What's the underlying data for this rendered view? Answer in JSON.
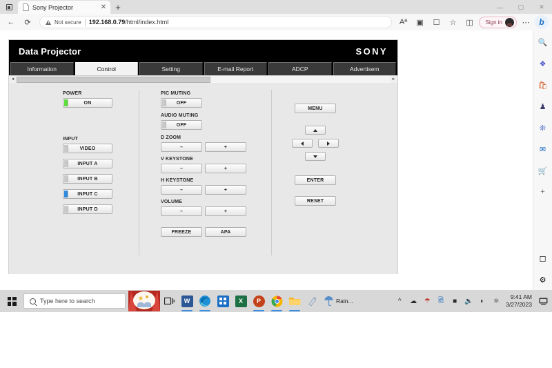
{
  "browser": {
    "tab": {
      "title": "Sony Projector",
      "close_label": "✕",
      "favicon": "page-icon"
    },
    "new_tab_label": "+",
    "tab_actions_icon": "tab-actions-icon",
    "window_controls": {
      "minimize": "—",
      "maximize": "▢",
      "close": "✕"
    },
    "nav": {
      "back": "←",
      "forward": "→",
      "refresh": "⟳"
    },
    "omnibox": {
      "security_label": "Not secure",
      "url_host": "192.168.0.79",
      "url_path": "/html/index.html"
    },
    "toolbar_icons": [
      "read-aloud-icon",
      "zoom-icon",
      "collections-icon",
      "favorites-icon",
      "split-screen-icon"
    ],
    "signin": {
      "label": "Sign in",
      "avatar": "user-avatar"
    },
    "copilot_label": "b",
    "sidebar_icons": [
      "search-icon",
      "discover-icon",
      "shopping-bag-icon",
      "games-icon",
      "copilot-icon",
      "outlook-icon",
      "shopping-cart-icon",
      "add-icon"
    ],
    "sidebar_bottom_icons": [
      "browser-essentials-icon",
      "settings-gear-icon"
    ]
  },
  "page": {
    "header": {
      "title": "Data Projector",
      "brand": "SONY"
    },
    "tabs": [
      {
        "label": "Information",
        "active": false
      },
      {
        "label": "Control",
        "active": true
      },
      {
        "label": "Setting",
        "active": false
      },
      {
        "label": "E-mail Report",
        "active": false
      },
      {
        "label": "ADCP",
        "active": false
      },
      {
        "label": "Advertisem",
        "active": false
      }
    ],
    "scrollbar": {
      "left_arrow": "◄",
      "right_arrow": "►",
      "thumb_percent": 52
    },
    "power": {
      "label": "POWER",
      "button": "ON",
      "indicator_color": "#5ddc3c",
      "state": "on"
    },
    "input": {
      "label": "INPUT",
      "items": [
        {
          "label": "VIDEO",
          "selected": false
        },
        {
          "label": "INPUT A",
          "selected": false
        },
        {
          "label": "INPUT B",
          "selected": false
        },
        {
          "label": "INPUT C",
          "selected": true
        },
        {
          "label": "INPUT D",
          "selected": false
        }
      ],
      "selected_color": "#2f8ade"
    },
    "pic_muting": {
      "label": "PIC MUTING",
      "button": "OFF"
    },
    "audio_muting": {
      "label": "AUDIO MUTING",
      "button": "OFF"
    },
    "d_zoom": {
      "label": "D ZOOM",
      "minus": "–",
      "plus": "+"
    },
    "v_keystone": {
      "label": "V KEYSTONE",
      "minus": "–",
      "plus": "+"
    },
    "h_keystone": {
      "label": "H KEYSTONE",
      "minus": "–",
      "plus": "+"
    },
    "volume": {
      "label": "VOLUME",
      "minus": "–",
      "plus": "+"
    },
    "freeze": "FREEZE",
    "apa": "APA",
    "menu": "MENU",
    "enter": "ENTER",
    "reset": "RESET",
    "dpad": {
      "up": "up-arrow-icon",
      "down": "down-arrow-icon",
      "left": "left-arrow-icon",
      "right": "right-arrow-icon"
    }
  },
  "taskbar": {
    "start_label": "start-icon",
    "search_placeholder": "Type here to search",
    "news_widget": "news-weather-widget",
    "apps": [
      {
        "name": "task-view",
        "glyph": "⊞",
        "color": "#2b2b2b",
        "running": false
      },
      {
        "name": "word",
        "glyph": "W",
        "color": "#2b5797",
        "running": true
      },
      {
        "name": "edge",
        "glyph": "e",
        "color": "#1f8fd6",
        "running": true
      },
      {
        "name": "microsoft-store",
        "glyph": "⊞",
        "color": "#1a6fc4",
        "running": false
      },
      {
        "name": "excel",
        "glyph": "X",
        "color": "#1d7044",
        "running": false
      },
      {
        "name": "powerpoint",
        "glyph": "P",
        "color": "#c4421a",
        "running": true
      },
      {
        "name": "chrome",
        "glyph": "◉",
        "color": "#e8453c",
        "running": true
      },
      {
        "name": "file-explorer",
        "glyph": "🗀",
        "color": "#f0b323",
        "running": true
      },
      {
        "name": "paint-3d",
        "glyph": "✎",
        "color": "#7a8b9a",
        "running": false
      }
    ],
    "weather": {
      "icon": "umbrella-icon",
      "label": "Rain..."
    },
    "tray": [
      "show-hidden-icons",
      "onedrive-icon",
      "defender-icon",
      "photos-icon",
      "battery-icon",
      "volume-icon",
      "network-icon",
      "bluetooth-icon"
    ],
    "clock": {
      "time": "9:41 AM",
      "date": "3/27/2023"
    },
    "notification_center": "notifications-icon"
  }
}
